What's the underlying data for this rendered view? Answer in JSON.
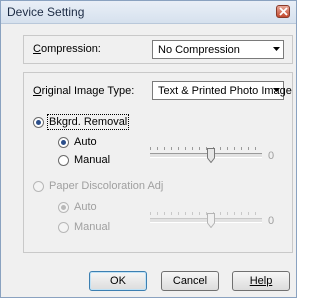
{
  "window": {
    "title": "Device Setting"
  },
  "compression": {
    "label": "Compression:",
    "value": "No Compression"
  },
  "image_type": {
    "label": "Original Image Type:",
    "value": "Text & Printed Photo Image"
  },
  "bkgrd": {
    "label": "Bkgrd. Removal",
    "auto_label": "Auto",
    "manual_label": "Manual",
    "slider_value": "0",
    "slider_level": 0.55
  },
  "paper": {
    "label": "Paper Discoloration Adj",
    "auto_label": "Auto",
    "manual_label": "Manual",
    "slider_value": "0",
    "slider_level": 0.55
  },
  "buttons": {
    "ok": "OK",
    "cancel": "Cancel",
    "help": "Help"
  }
}
